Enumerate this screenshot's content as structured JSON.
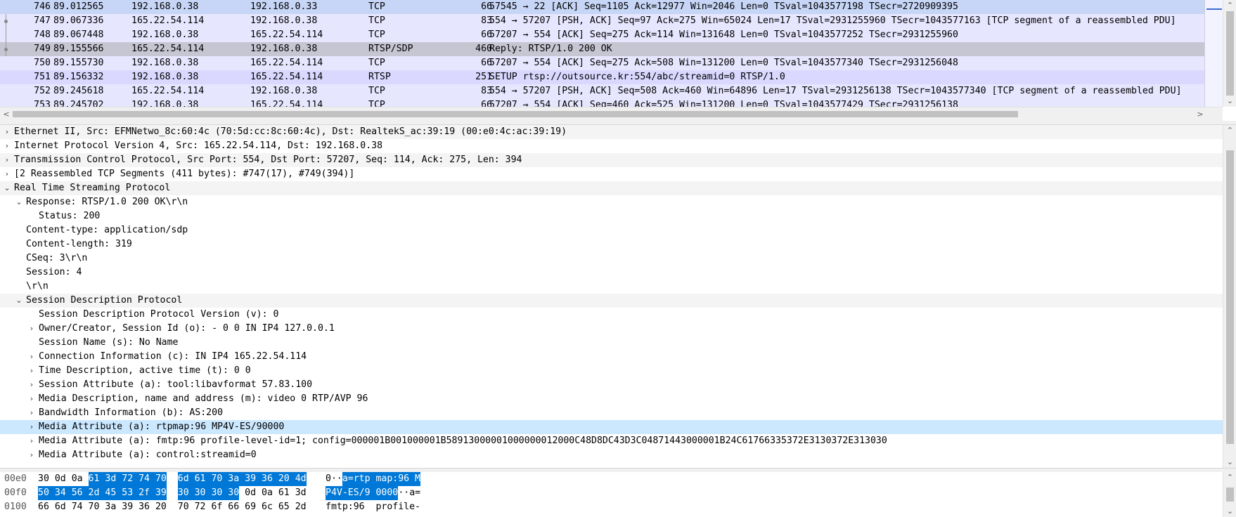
{
  "packet_list": {
    "rows": [
      {
        "no": "746",
        "time": "89.012565",
        "src": "192.168.0.38",
        "dst": "192.168.0.33",
        "proto": "TCP",
        "len": "66",
        "info": "57545 → 22 [ACK] Seq=1105 Ack=12977 Win=2046 Len=0 TSval=1043577198 TSecr=2720909395",
        "style": "top"
      },
      {
        "no": "747",
        "time": "89.067336",
        "src": "165.22.54.114",
        "dst": "192.168.0.38",
        "proto": "TCP",
        "len": "83",
        "info": "554 → 57207 [PSH, ACK] Seq=97 Ack=275 Win=65024 Len=17 TSval=2931255960 TSecr=1043577163 [TCP segment of a reassembled PDU]",
        "style": "normal",
        "mark": "dot"
      },
      {
        "no": "748",
        "time": "89.067448",
        "src": "192.168.0.38",
        "dst": "165.22.54.114",
        "proto": "TCP",
        "len": "66",
        "info": "57207 → 554 [ACK] Seq=275 Ack=114 Win=131648 Len=0 TSval=1043577252 TSecr=2931255960",
        "style": "normal",
        "mark": "line"
      },
      {
        "no": "749",
        "time": "89.155566",
        "src": "165.22.54.114",
        "dst": "192.168.0.38",
        "proto": "RTSP/SDP",
        "len": "460",
        "info": "Reply: RTSP/1.0 200 OK",
        "style": "selected",
        "mark": "dot"
      },
      {
        "no": "750",
        "time": "89.155730",
        "src": "192.168.0.38",
        "dst": "165.22.54.114",
        "proto": "TCP",
        "len": "66",
        "info": "57207 → 554 [ACK] Seq=275 Ack=508 Win=131200 Len=0 TSval=1043577340 TSecr=2931256048",
        "style": "normal"
      },
      {
        "no": "751",
        "time": "89.156332",
        "src": "192.168.0.38",
        "dst": "165.22.54.114",
        "proto": "RTSP",
        "len": "251",
        "info": "SETUP rtsp://outsource.kr:554/abc/streamid=0 RTSP/1.0",
        "style": "rtsp"
      },
      {
        "no": "752",
        "time": "89.245618",
        "src": "165.22.54.114",
        "dst": "192.168.0.38",
        "proto": "TCP",
        "len": "83",
        "info": "554 → 57207 [PSH, ACK] Seq=508 Ack=460 Win=64896 Len=17 TSval=2931256138 TSecr=1043577340 [TCP segment of a reassembled PDU]",
        "style": "normal"
      },
      {
        "no": "753",
        "time": "89.245702",
        "src": "192.168.0.38",
        "dst": "165.22.54.114",
        "proto": "TCP",
        "len": "66",
        "info": "57207 → 554 [ACK] Seq=460 Ack=525 Win=131200 Len=0 TSval=1043577429 TSecr=2931256138",
        "style": "normal"
      }
    ]
  },
  "details": {
    "rows": [
      {
        "text": "Ethernet II, Src: EFMNetwo_8c:60:4c (70:5d:cc:8c:60:4c), Dst: RealtekS_ac:39:19 (00:e0:4c:ac:39:19)",
        "level": 0,
        "toggle": "collapsed",
        "bg": "alt"
      },
      {
        "text": "Internet Protocol Version 4, Src: 165.22.54.114, Dst: 192.168.0.38",
        "level": 0,
        "toggle": "collapsed",
        "bg": "none"
      },
      {
        "text": "Transmission Control Protocol, Src Port: 554, Dst Port: 57207, Seq: 114, Ack: 275, Len: 394",
        "level": 0,
        "toggle": "collapsed",
        "bg": "alt"
      },
      {
        "text": "[2 Reassembled TCP Segments (411 bytes): #747(17), #749(394)]",
        "level": 0,
        "toggle": "collapsed",
        "bg": "none"
      },
      {
        "text": "Real Time Streaming Protocol",
        "level": 0,
        "toggle": "expanded",
        "bg": "alt"
      },
      {
        "text": "Response: RTSP/1.0 200 OK\\r\\n",
        "level": 1,
        "toggle": "expanded",
        "bg": "none"
      },
      {
        "text": "Status: 200",
        "level": 2,
        "toggle": "none",
        "bg": "none"
      },
      {
        "text": "Content-type: application/sdp",
        "level": 1,
        "toggle": "none",
        "bg": "none"
      },
      {
        "text": "Content-length: 319",
        "level": 1,
        "toggle": "none",
        "bg": "none"
      },
      {
        "text": "CSeq: 3\\r\\n",
        "level": 1,
        "toggle": "none",
        "bg": "none"
      },
      {
        "text": "Session: 4",
        "level": 1,
        "toggle": "none",
        "bg": "none"
      },
      {
        "text": "\\r\\n",
        "level": 1,
        "toggle": "none",
        "bg": "none"
      },
      {
        "text": "Session Description Protocol",
        "level": 1,
        "toggle": "expanded",
        "bg": "alt"
      },
      {
        "text": "Session Description Protocol Version (v): 0",
        "level": 2,
        "toggle": "none",
        "bg": "none"
      },
      {
        "text": "Owner/Creator, Session Id (o): - 0 0 IN IP4 127.0.0.1",
        "level": 2,
        "toggle": "collapsed",
        "bg": "none"
      },
      {
        "text": "Session Name (s): No Name",
        "level": 2,
        "toggle": "none",
        "bg": "none"
      },
      {
        "text": "Connection Information (c): IN IP4 165.22.54.114",
        "level": 2,
        "toggle": "collapsed",
        "bg": "none"
      },
      {
        "text": "Time Description, active time (t): 0 0",
        "level": 2,
        "toggle": "collapsed",
        "bg": "none"
      },
      {
        "text": "Session Attribute (a): tool:libavformat 57.83.100",
        "level": 2,
        "toggle": "collapsed",
        "bg": "none"
      },
      {
        "text": "Media Description, name and address (m): video 0 RTP/AVP 96",
        "level": 2,
        "toggle": "collapsed",
        "bg": "none"
      },
      {
        "text": "Bandwidth Information (b): AS:200",
        "level": 2,
        "toggle": "collapsed",
        "bg": "none"
      },
      {
        "text": "Media Attribute (a): rtpmap:96 MP4V-ES/90000",
        "level": 2,
        "toggle": "collapsed",
        "bg": "hl"
      },
      {
        "text": "Media Attribute (a): fmtp:96 profile-level-id=1; config=000001B001000001B58913000001000000012000C48D8DC43D3C04871443000001B24C61766335372E3130372E313030",
        "level": 2,
        "toggle": "collapsed",
        "bg": "none"
      },
      {
        "text": "Media Attribute (a): control:streamid=0",
        "level": 2,
        "toggle": "collapsed",
        "bg": "none"
      }
    ]
  },
  "hex": {
    "rows": [
      {
        "offset": "00e0",
        "bytes_a": [
          "30",
          "0d",
          "0a",
          "61",
          "3d",
          "72",
          "74",
          "70"
        ],
        "bytes_b": [
          "6d",
          "61",
          "70",
          "3a",
          "39",
          "36",
          "20",
          "4d"
        ],
        "sel_a_from": 3,
        "sel_a_to": 7,
        "sel_b_from": 0,
        "sel_b_to": 7,
        "ascii_plain": "0··",
        "ascii_sel": "a=rtp map:96 M",
        "ascii_rest": ""
      },
      {
        "offset": "00f0",
        "bytes_a": [
          "50",
          "34",
          "56",
          "2d",
          "45",
          "53",
          "2f",
          "39"
        ],
        "bytes_b": [
          "30",
          "30",
          "30",
          "30",
          "0d",
          "0a",
          "61",
          "3d"
        ],
        "sel_a_from": 0,
        "sel_a_to": 7,
        "sel_b_from": 0,
        "sel_b_to": 3,
        "ascii_plain": "",
        "ascii_sel": "P4V-ES/9 0000",
        "ascii_rest": "··a="
      },
      {
        "offset": "0100",
        "bytes_a": [
          "66",
          "6d",
          "74",
          "70",
          "3a",
          "39",
          "36",
          "20"
        ],
        "bytes_b": [
          "70",
          "72",
          "6f",
          "66",
          "69",
          "6c",
          "65",
          "2d"
        ],
        "sel_a_from": -1,
        "sel_a_to": -1,
        "sel_b_from": -1,
        "sel_b_to": -1,
        "ascii_plain": "fmtp:96  profile-",
        "ascii_sel": "",
        "ascii_rest": ""
      }
    ]
  },
  "icons": {
    "collapsed": "chevron-right-icon",
    "expanded": "chevron-down-icon"
  },
  "colors": {
    "selection": "#0078d7",
    "rtsp_row": "#dad8ff",
    "tcp_row": "#e7e6ff",
    "selected_row": "#c6c6d2",
    "highlight_field": "#cce8ff"
  }
}
